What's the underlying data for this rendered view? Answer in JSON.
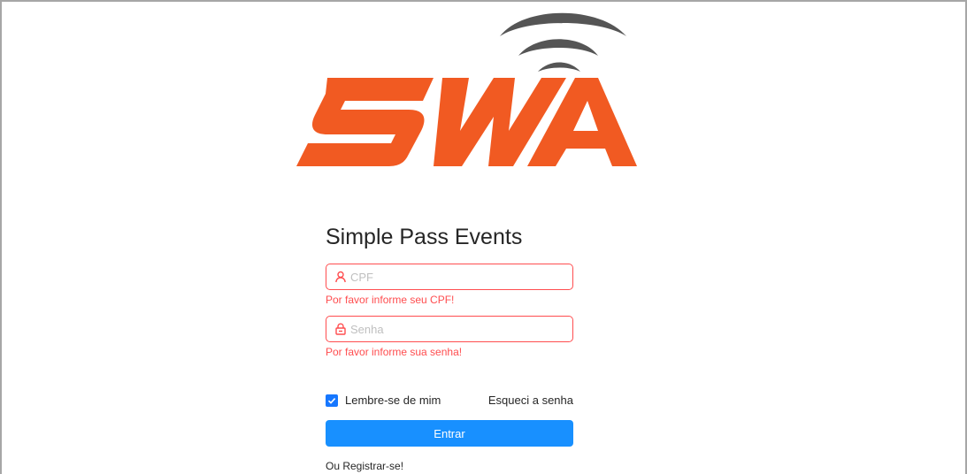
{
  "brand": {
    "logo_text": "SWA",
    "logo_color": "#f15a22",
    "waves_color": "#555555"
  },
  "form": {
    "title": "Simple Pass Events",
    "cpf": {
      "placeholder": "CPF",
      "value": "",
      "error": "Por favor informe seu CPF!",
      "icon": "user-icon"
    },
    "password": {
      "placeholder": "Senha",
      "value": "",
      "error": "Por favor informe sua senha!",
      "icon": "lock-icon"
    },
    "remember": {
      "label": "Lembre-se de mim",
      "checked": true
    },
    "forgot_label": "Esqueci a senha",
    "submit_label": "Entrar",
    "register": {
      "prefix": "Ou ",
      "link_label": "Registrar-se!"
    }
  },
  "colors": {
    "error": "#ff4d4f",
    "primary": "#1890ff",
    "checkbox": "#1677ff"
  }
}
